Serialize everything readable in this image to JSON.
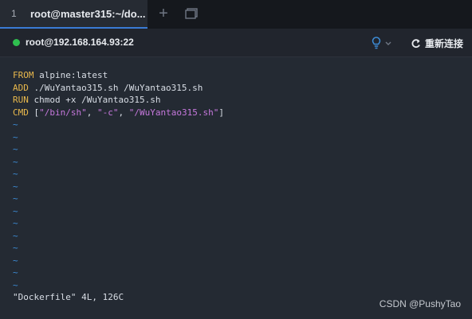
{
  "tab": {
    "index": "1",
    "title": "root@master315:~/do..."
  },
  "toolbar": {
    "host": "root@192.168.164.93:22",
    "reconnect_label": "重新连接",
    "status_color": "#2fbf4f",
    "bulb_icon": "lightbulb-icon"
  },
  "terminal": {
    "lines": [
      {
        "kw": "FROM",
        "rest": " alpine:latest"
      },
      {
        "kw": "ADD",
        "rest": " ./WuYantao315.sh /WuYantao315.sh"
      },
      {
        "kw": "RUN",
        "rest": " chmod +x /WuYantao315.sh"
      }
    ],
    "cmd": {
      "kw": "CMD",
      "open": " [",
      "s1": "\"/bin/sh\"",
      "sep1": ", ",
      "s2": "\"-c\"",
      "sep2": ", ",
      "s3": "\"/WuYantao315.sh\"",
      "close": "]"
    },
    "tilde": "~",
    "tilde_count": 14,
    "status_line": "\"Dockerfile\" 4L, 126C"
  },
  "watermark": "CSDN @PushyTao"
}
